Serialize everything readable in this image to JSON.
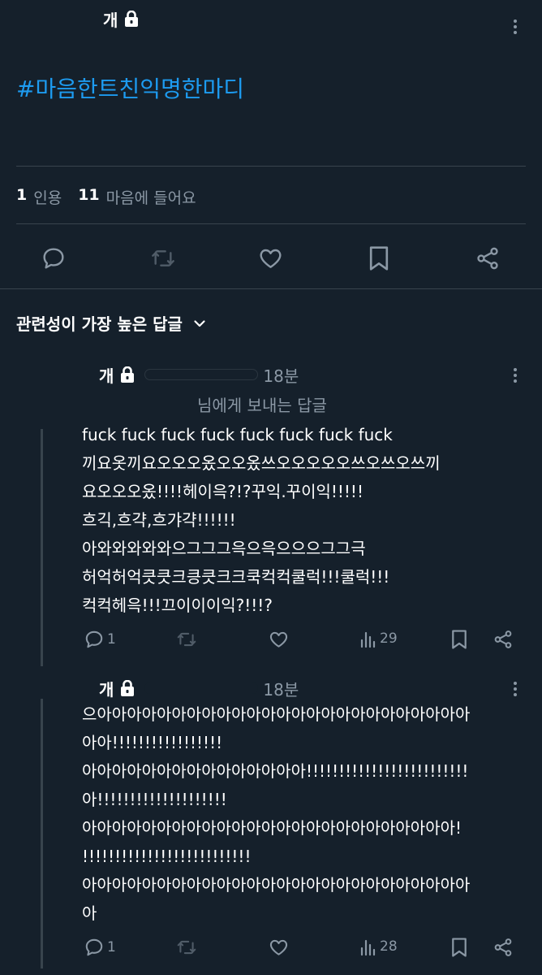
{
  "main_tweet": {
    "author_name": "개",
    "hashtag": "#마음한트친익명한마디",
    "stats": {
      "quotes_count": "1",
      "quotes_label": "인용",
      "likes_count": "11",
      "likes_label": "마음에 들어요"
    }
  },
  "replies_header": {
    "sort_label": "관련성이 가장 높은 답글"
  },
  "replies": [
    {
      "author_name": "개",
      "time": "18분",
      "reply_to": "님에게 보내는 답글",
      "text": "fuck fuck fuck fuck fuck fuck fuck fuck\n끼요옷끼요오오오옸오오옸쓰오오오오오쓰오쓰오쓰끼\n요오오오옸!!!!헤이윽?!?꾸익.꾸이익!!!!!\n흐긱,흐갹,흐갸갹!!!!!!\n아와와와와와으그그그윽으윽으으으그그극\n허억허억큿큿크킁큿크크쿡컥컥쿨럭!!!쿨럭!!!\n컥컥헤윽!!!끄이이이익?!!!?",
      "replies_count": "1",
      "views": "29"
    },
    {
      "author_name": "개",
      "time": "18분",
      "text": "으아아아아아아아아아아아아아아아아아아아아아아아아아\n아아!!!!!!!!!!!!!!!!!\n아아아아아아아아아아아아아아아!!!!!!!!!!!!!!!!!!!!!!!!!\n아!!!!!!!!!!!!!!!!!!!!\n아아아아아아아아아아아아아아아아아아아아아아아아아!\n!!!!!!!!!!!!!!!!!!!!!!!!!!\n아아아아아아아아아아아아아아아아아아아아아아아아아아\n아",
      "replies_count": "1",
      "views": "28"
    }
  ],
  "colors": {
    "background": "#15202b",
    "hashtag": "#1d9bf0",
    "muted": "#8b98a5",
    "divider": "#38444d"
  },
  "icons": {
    "lock": "lock-icon",
    "more": "more-options-icon",
    "reply": "comment-icon",
    "retweet": "retweet-icon",
    "like": "heart-icon",
    "bookmark": "bookmark-icon",
    "share": "share-icon",
    "views": "analytics-icon",
    "sort": "chevron-down-icon"
  }
}
